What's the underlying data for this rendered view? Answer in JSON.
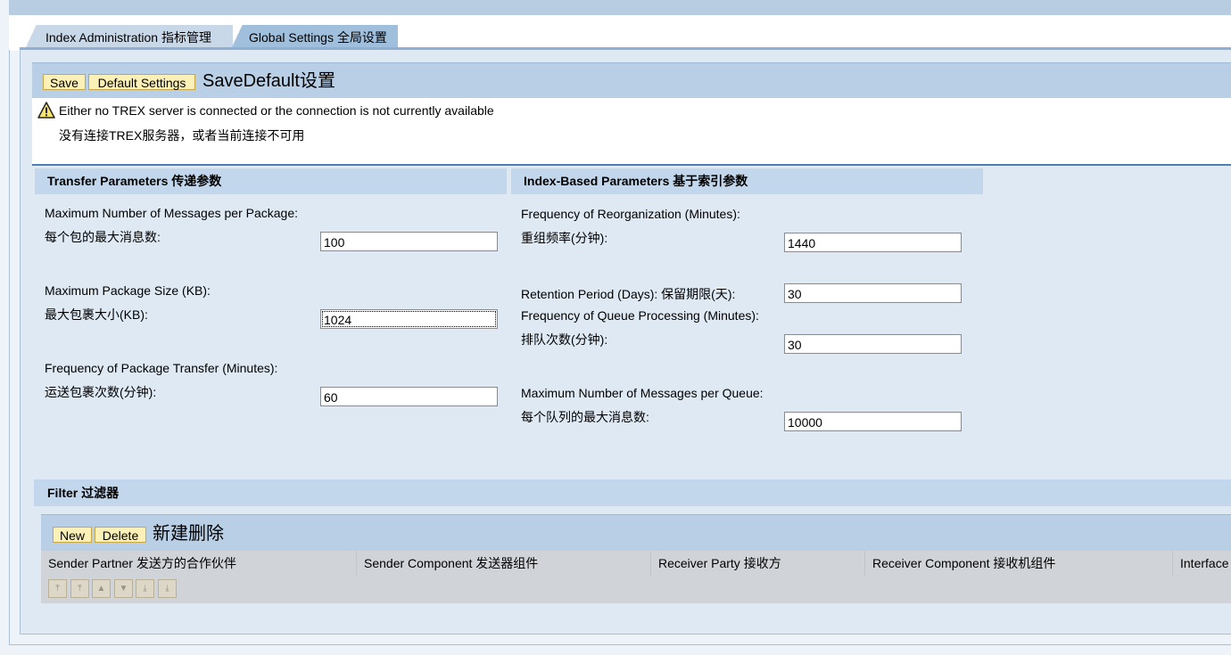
{
  "tabs": [
    {
      "label": "Index Administration 指标管理"
    },
    {
      "label": "Global Settings 全局设置"
    }
  ],
  "toolbar": {
    "save_label": "Save",
    "default_settings_label": "Default Settings",
    "title": "SaveDefault设置"
  },
  "message": {
    "text_en": "Either no TREX server is connected or the connection is not currently available",
    "text_zh": "没有连接TREX服务器，或者当前连接不可用"
  },
  "transfer": {
    "header": "Transfer Parameters 传递参数",
    "max_messages_label_en": "Maximum Number of Messages per Package:",
    "max_messages_label_zh": "每个包的最大消息数:",
    "max_messages_value": "100",
    "max_size_label_en": "Maximum Package Size (KB):",
    "max_size_label_zh": "最大包裹大小(KB):",
    "max_size_value": "1024",
    "freq_transfer_label_en": "Frequency of Package Transfer (Minutes):",
    "freq_transfer_label_zh": "运送包裹次数(分钟):",
    "freq_transfer_value": "60"
  },
  "index": {
    "header": "Index-Based Parameters 基于索引参数",
    "reorg_label_en": "Frequency of Reorganization (Minutes):",
    "reorg_label_zh": "重组频率(分钟):",
    "reorg_value": "1440",
    "retention_label": "Retention Period (Days): 保留期限(天):",
    "retention_value": "30",
    "queue_label_en": "Frequency of Queue Processing (Minutes):",
    "queue_label_zh": "排队次数(分钟):",
    "queue_value": "30",
    "max_queue_label_en": "Maximum Number of Messages per Queue:",
    "max_queue_label_zh": "每个队列的最大消息数:",
    "max_queue_value": "10000"
  },
  "filter": {
    "header": "Filter 过滤器",
    "new_label": "New",
    "delete_label": "Delete",
    "title": "新建删除",
    "columns": [
      "Sender Partner 发送方的合作伙伴",
      "Sender Component 发送器组件",
      "Receiver Party 接收方",
      "Receiver Component 接收机组件",
      "Interface"
    ],
    "nav_icons": [
      "first-page-icon",
      "previous-page-icon",
      "previous-row-icon",
      "next-row-icon",
      "next-page-icon",
      "last-page-icon"
    ]
  }
}
